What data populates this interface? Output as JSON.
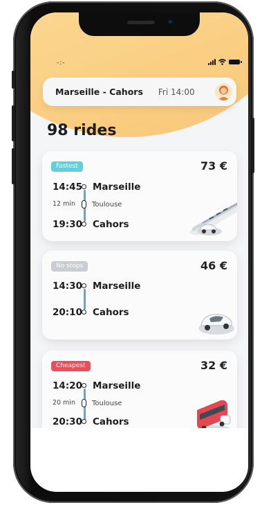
{
  "status": {
    "left": "-:-"
  },
  "search": {
    "route": "Marseille - Cahors",
    "date": "Fri 14:00"
  },
  "results": {
    "title": "98 rides"
  },
  "rides": [
    {
      "badge": "Fastest",
      "badge_color": "#5fd0dc",
      "price": "73 €",
      "dep_time": "14:45",
      "dep_city": "Marseille",
      "duration": "12 min",
      "via": "Toulouse",
      "arr_time": "19:30",
      "arr_city": "Cahors",
      "vehicle": "train-icon"
    },
    {
      "badge": "No stops",
      "badge_color": "#c9ccd1",
      "price": "46 €",
      "dep_time": "14:30",
      "dep_city": "Marseille",
      "arr_time": "20:10",
      "arr_city": "Cahors",
      "vehicle": "car-icon"
    },
    {
      "badge": "Cheapest",
      "badge_color": "#e8505b",
      "price": "32 €",
      "dep_time": "14:20",
      "dep_city": "Marseille",
      "duration": "20 min",
      "via": "Toulouse",
      "arr_time": "20:30",
      "arr_city": "Cahors",
      "vehicle": "bus-icon"
    }
  ]
}
